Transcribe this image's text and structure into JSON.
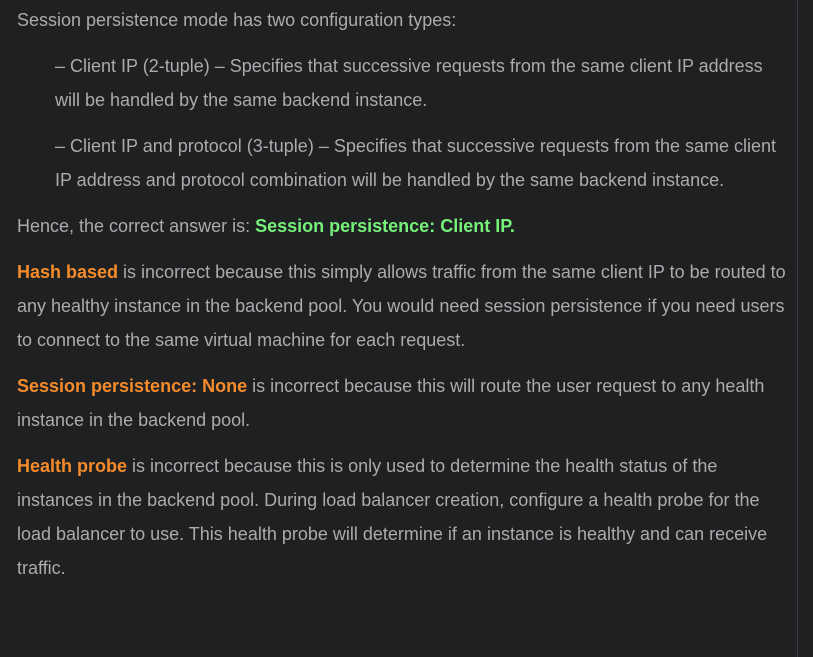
{
  "intro": "Session persistence mode has two configuration types:",
  "bullets": [
    "– Client IP (2-tuple) – Specifies that successive requests from the same client IP address will be handled by the same backend instance.",
    "– Client IP and protocol (3-tuple) – Specifies that successive requests from the same client IP address and protocol combination will be handled by the same backend instance."
  ],
  "answer": {
    "prefix": "Hence, the correct answer is: ",
    "highlight": "Session persistence: Client IP."
  },
  "explanations": [
    {
      "term": "Hash based",
      "text": " is incorrect because this simply allows traffic from the same client IP to be routed to any healthy instance in the backend pool. You would need session persistence if you need users to connect to the same virtual machine for each request."
    },
    {
      "term": "Session persistence: None",
      "text": " is incorrect because this will route the user request to any health instance in the backend pool."
    },
    {
      "term": "Health probe",
      "text": " is incorrect because this is only used to determine the health status of the instances in the backend pool. During load balancer creation, configure a health probe for the load balancer to use. This health probe will determine if an instance is healthy and can receive traffic."
    }
  ],
  "colors": {
    "background": "#1f2022",
    "text": "#a9abad",
    "correct_highlight": "#77f07a",
    "incorrect_highlight": "#f58b2a"
  }
}
